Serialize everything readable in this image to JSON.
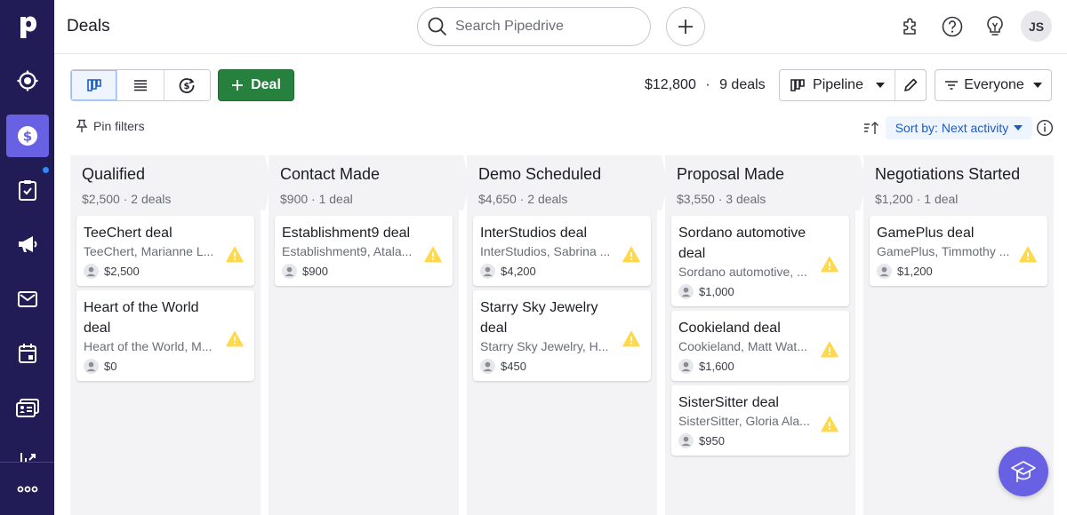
{
  "app": {
    "title": "Deals"
  },
  "colors": {
    "sidebar": "#211c55",
    "accent": "#6861e3",
    "primary_button": "#26803e",
    "link": "#1d5bc4",
    "warning": "#ffd94a"
  },
  "sidebar": {
    "items": [
      {
        "name": "leads",
        "icon": "target-icon"
      },
      {
        "name": "deals",
        "icon": "dollar-icon",
        "active": true
      },
      {
        "name": "activities",
        "icon": "clipboard-check-icon",
        "notification_dot": true
      },
      {
        "name": "campaigns",
        "icon": "megaphone-icon"
      },
      {
        "name": "mail",
        "icon": "mail-icon"
      },
      {
        "name": "calendar",
        "icon": "calendar-icon"
      },
      {
        "name": "contacts",
        "icon": "contact-card-icon"
      },
      {
        "name": "insights",
        "icon": "chart-icon"
      },
      {
        "name": "more",
        "icon": "more-icon"
      }
    ]
  },
  "header": {
    "search_placeholder": "Search Pipedrive",
    "avatar_initials": "JS"
  },
  "toolbar": {
    "add_deal_label": "Deal",
    "total_value": "$12,800",
    "separator": "·",
    "deal_count": "9 deals",
    "pipeline_label": "Pipeline",
    "owner_filter_label": "Everyone",
    "pin_filters_label": "Pin filters",
    "sort_label": "Sort by: Next activity"
  },
  "stages": [
    {
      "title": "Qualified",
      "summary": "$2,500 · 2 deals",
      "deals": [
        {
          "title": "TeeChert deal",
          "org": "TeeChert, Marianne L...",
          "value": "$2,500"
        },
        {
          "title": "Heart of the World deal",
          "org": "Heart of the World, M...",
          "value": "$0"
        }
      ]
    },
    {
      "title": "Contact Made",
      "summary": "$900 · 1 deal",
      "deals": [
        {
          "title": "Establishment9 deal",
          "org": "Establishment9, Atala...",
          "value": "$900"
        }
      ]
    },
    {
      "title": "Demo Scheduled",
      "summary": "$4,650 · 2 deals",
      "deals": [
        {
          "title": "InterStudios deal",
          "org": "InterStudios, Sabrina ...",
          "value": "$4,200"
        },
        {
          "title": "Starry Sky Jewelry deal",
          "org": "Starry Sky Jewelry, H...",
          "value": "$450"
        }
      ]
    },
    {
      "title": "Proposal Made",
      "summary": "$3,550 · 3 deals",
      "deals": [
        {
          "title": "Sordano automotive deal",
          "org": "Sordano automotive, ...",
          "value": "$1,000"
        },
        {
          "title": "Cookieland deal",
          "org": "Cookieland, Matt Wat...",
          "value": "$1,600"
        },
        {
          "title": "SisterSitter deal",
          "org": "SisterSitter, Gloria Ala...",
          "value": "$950"
        }
      ]
    },
    {
      "title": "Negotiations Started",
      "summary": "$1,200 · 1 deal",
      "deals": [
        {
          "title": "GamePlus deal",
          "org": "GamePlus, Timmothy ...",
          "value": "$1,200"
        }
      ]
    }
  ]
}
